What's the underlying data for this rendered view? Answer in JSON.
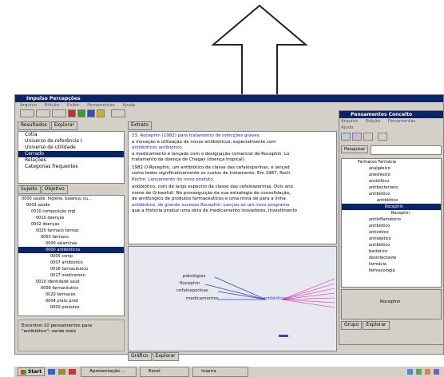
{
  "main_window": {
    "title": "Impulso Percepções",
    "menus": [
      "Arquivo",
      "Edição",
      "Exibir",
      "Ferramentas",
      "Ajuda"
    ]
  },
  "left_panel": {
    "tabs": [
      "Resultados",
      "Explorar"
    ],
    "list_items": [
      "Cotia",
      "Universo de referência I",
      "Universo de utilidade",
      "Cerrado",
      "Relações",
      "Categorias frequentes"
    ],
    "selected_index": 3,
    "tree_tabs": [
      "Sujeito",
      "Objetivo"
    ],
    "tree_items": [
      "0000 saúde: higiene, balança, cu...",
      "0003 saúde",
      "0010 composição orgi",
      "0010 doenças",
      "0002 doenças",
      "0020 farmaco farmac",
      "0050 farmaco",
      "0000 salaminas",
      "0000 antibióticos",
      "0005 comp",
      "0007 antibiotico",
      "0016 farmacêutico",
      "0017 medicamen",
      "0010 identidade saúd",
      "0009 farmacêutico",
      "0020 farmacos",
      "0004 prato prod",
      "0000 produtos"
    ],
    "selected_tree_index": 8,
    "status": "Encontrei 10 pensamentos para \"antibiótico\"; verde mais"
  },
  "center_panel": {
    "tab": "Extrato",
    "text_lines": [
      "23. Rocephin (1982) para tratamento de infecções graves.",
      "a inovação e utilização de novos antibióticos, especialmente com",
      "antibióticos antibiótico.",
      "a medicamento e lançado com o designação comercial de Rocephin. Lo",
      "tratamento da doença de Chagas (doença tropical).",
      "1982 O Rocephin, um antibiótico da classe das cefalosporinas, é lançad",
      "como todos significativamente os custos de tratamento. Em 1987, Roch",
      "Roche: Lançamento do novo produto.",
      "antibiótico, com de largo espectro da classe das cefalosporinas. Dois ano",
      "nome de Griseofull. No prosseguição da sua estratégia de consolidação,",
      "de antifúngico de produtos farmacêuticos e uma mina de para a linha",
      "antibiótico, de grande sucesso Rocephin. Lançou-se um novo programa",
      "que a História produz uma obra de medicamento inovadores, investimento"
    ],
    "graph_labels": [
      "patologias",
      "Rocephin",
      "cefalosporinas",
      "medicamentos"
    ],
    "graph_center": "antibiótico",
    "bottom_tabs": [
      "Gráfico",
      "Explorar"
    ]
  },
  "right_window": {
    "title": "Pensamentos Conceito",
    "menus": [
      "Arquivo",
      "Edição",
      "Ferramentas"
    ],
    "menu2": "Ajuda",
    "search_label": "Pesquisar",
    "tree_items": [
      "Farmacos Farmácia",
      "analgésico",
      "anestésico",
      "ansiolítico",
      "antibacteriano",
      "antibiótico",
      "antibiótico",
      "Rocephin",
      "Rocephin",
      "antiinflamatório",
      "antibiótico",
      "anticético",
      "antiséptico",
      "antibiótico",
      "bactérico",
      "desinfectante",
      "farmácia",
      "farmacologia"
    ],
    "selected_index": 7,
    "bottom_label": "Rocephin",
    "bottom_tabs": [
      "Grupo",
      "Explorar"
    ]
  },
  "taskbar": {
    "start": "Start",
    "buttons": [
      "Apresentação ...",
      "Excel",
      "Inspira"
    ]
  },
  "colors": {
    "title_bar": "#0a246a",
    "graph_pink": "#cc33aa",
    "graph_blue": "#3344bb"
  }
}
